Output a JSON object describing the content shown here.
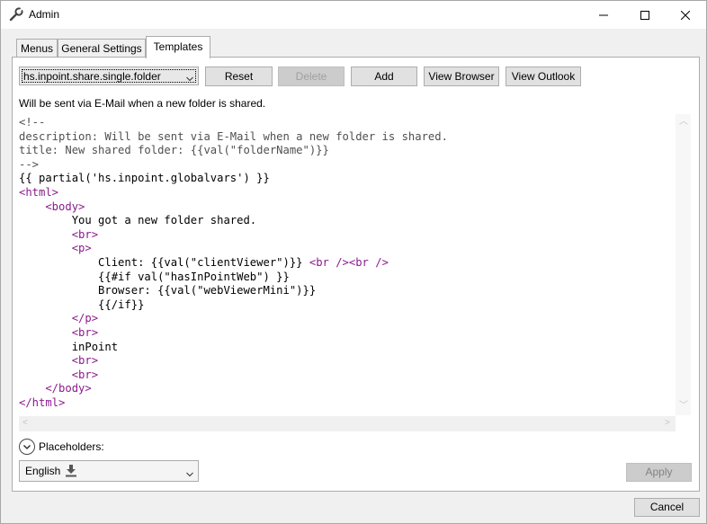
{
  "window": {
    "title": "Admin",
    "icons": {
      "app": "wrench-icon",
      "minimize": "minimize-icon",
      "maximize": "maximize-icon",
      "close": "close-icon"
    }
  },
  "tabs": [
    {
      "label": "Menus",
      "active": false
    },
    {
      "label": "General Settings",
      "active": false
    },
    {
      "label": "Templates",
      "active": true
    }
  ],
  "toolbar": {
    "template_select": "hs.inpoint.share.single.folder",
    "reset_label": "Reset",
    "delete_label": "Delete",
    "add_label": "Add",
    "view_browser_label": "View Browser",
    "view_outlook_label": "View Outlook"
  },
  "description": "Will be sent via E-Mail when a new folder is shared.",
  "editor": {
    "lines": [
      {
        "text": "<!--",
        "kind": "comment"
      },
      {
        "text": "description: Will be sent via E-Mail when a new folder is shared.",
        "kind": "comment"
      },
      {
        "text": "title: New shared folder: {{val(\"folderName\")}}",
        "kind": "comment"
      },
      {
        "text": "-->",
        "kind": "comment"
      },
      {
        "text": "{{ partial('hs.inpoint.globalvars') }}",
        "kind": "text"
      },
      {
        "text": "<html>",
        "kind": "tag"
      },
      {
        "text": "    <body>",
        "kind": "tag"
      },
      {
        "text": "        You got a new folder shared.",
        "kind": "text"
      },
      {
        "text": "        <br>",
        "kind": "tag"
      },
      {
        "text": "        <p>",
        "kind": "tag"
      },
      {
        "segments": [
          {
            "text": "            Client: {{val(\"clientViewer\")}} ",
            "kind": "text"
          },
          {
            "text": "<br /><br />",
            "kind": "tag"
          }
        ]
      },
      {
        "text": "            {{#if val(\"hasInPointWeb\") }}",
        "kind": "text"
      },
      {
        "text": "            Browser: {{val(\"webViewerMini\")}}",
        "kind": "text"
      },
      {
        "text": "            {{/if}}",
        "kind": "text"
      },
      {
        "text": "        </p>",
        "kind": "tag"
      },
      {
        "text": "        <br>",
        "kind": "tag"
      },
      {
        "text": "        inPoint",
        "kind": "text"
      },
      {
        "text": "        <br>",
        "kind": "tag"
      },
      {
        "text": "        <br>",
        "kind": "tag"
      },
      {
        "text": "    </body>",
        "kind": "tag"
      },
      {
        "text": "</html>",
        "kind": "tag"
      }
    ]
  },
  "placeholders_label": "Placeholders:",
  "language": {
    "selected": "English",
    "icon": "download-icon"
  },
  "apply_label": "Apply",
  "cancel_label": "Cancel",
  "colors": {
    "tag": "#8b1a8b",
    "comment": "#505050",
    "text": "#000000"
  }
}
